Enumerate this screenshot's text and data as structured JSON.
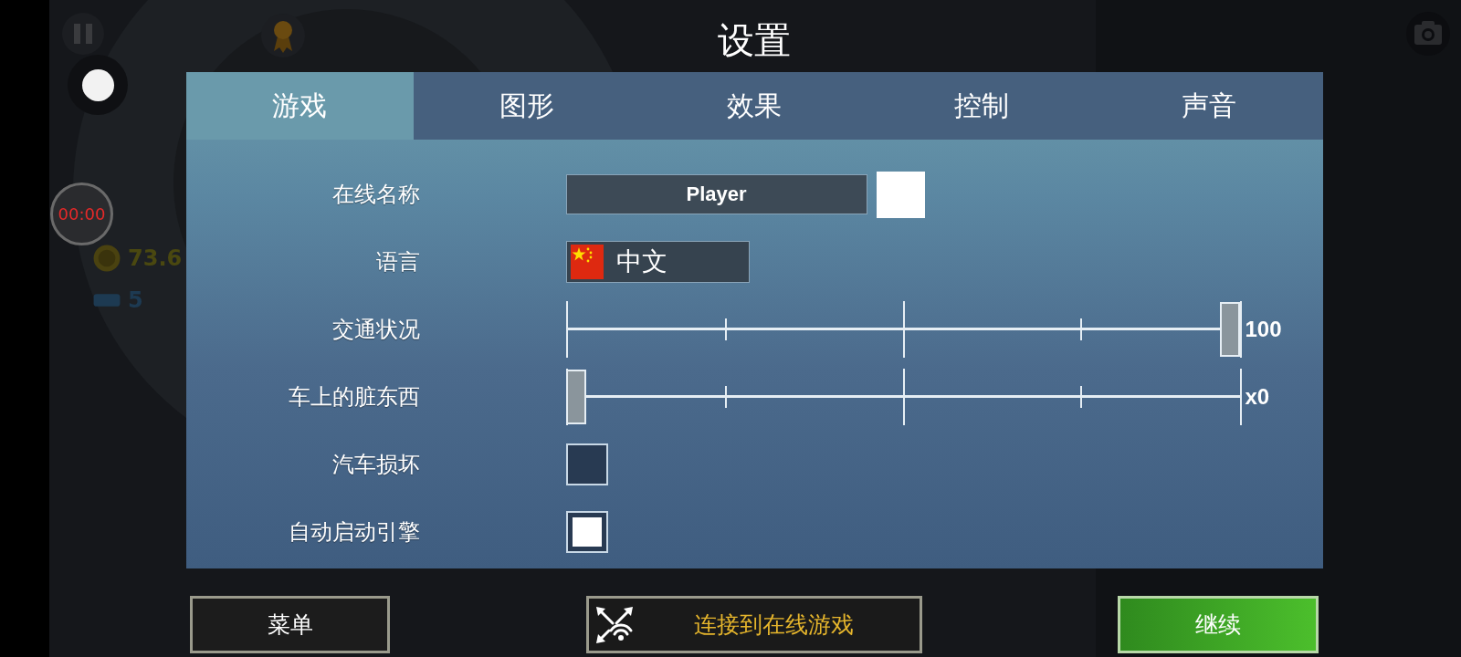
{
  "title": "设置",
  "hud": {
    "timer": "00:00",
    "coins": "73.6",
    "cars": "5"
  },
  "tabs": [
    {
      "label": "游戏",
      "selected": true
    },
    {
      "label": "图形",
      "selected": false
    },
    {
      "label": "效果",
      "selected": false
    },
    {
      "label": "控制",
      "selected": false
    },
    {
      "label": "声音",
      "selected": false
    }
  ],
  "settings": [
    {
      "kind": "text",
      "label": "在线名称",
      "value": "Player",
      "color": "#ffffff"
    },
    {
      "kind": "language",
      "label": "语言",
      "value": "中文"
    },
    {
      "kind": "slider",
      "label": "交通状况",
      "level": 1,
      "reading": "100"
    },
    {
      "kind": "slider",
      "label": "车上的脏东西",
      "level": 0,
      "reading": "x0"
    },
    {
      "kind": "checkbox",
      "label": "汽车损坏",
      "checked": false
    },
    {
      "kind": "checkbox",
      "label": "自动启动引擎",
      "checked": true
    }
  ],
  "buttons": [
    {
      "kind": "plain",
      "label": "菜单"
    },
    {
      "kind": "online",
      "label": "连接到在线游戏"
    },
    {
      "kind": "primary",
      "label": "继续"
    }
  ]
}
